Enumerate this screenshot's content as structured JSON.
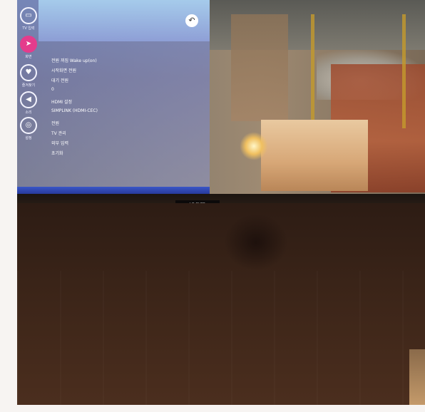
{
  "screen": {
    "sidebar": [
      {
        "icon": "tv-input-icon",
        "glyph": "▭",
        "label": "TV 입력",
        "active": false
      },
      {
        "icon": "pointer-icon",
        "glyph": "➤",
        "label": "화면",
        "active": true
      },
      {
        "icon": "heart-icon",
        "glyph": "♥",
        "label": "즐겨찾기",
        "active": false
      },
      {
        "icon": "speaker-icon",
        "glyph": "◀",
        "label": "소리",
        "active": false
      },
      {
        "icon": "settings-icon",
        "glyph": "◎",
        "label": "설정",
        "active": false
      }
    ],
    "back_glyph": "↶",
    "menu": [
      {
        "label": "전원 꺼짐 Wake up(on)",
        "desc": ""
      },
      {
        "label": "시작화면 전원",
        "desc": ""
      },
      {
        "label": "대기 전원",
        "desc": ""
      },
      {
        "label": "0",
        "desc": ""
      },
      {
        "label": "HDMI 설정",
        "desc": ""
      },
      {
        "label": "SIMPLINK (HDMI-CEC)",
        "desc": ""
      },
      {
        "label": "전원",
        "desc": ""
      },
      {
        "label": "TV 관리",
        "desc": ""
      },
      {
        "label": "외부 입력",
        "desc": ""
      },
      {
        "label": "초기화",
        "desc": ""
      }
    ]
  },
  "cabinet_badge": "LG OLED"
}
